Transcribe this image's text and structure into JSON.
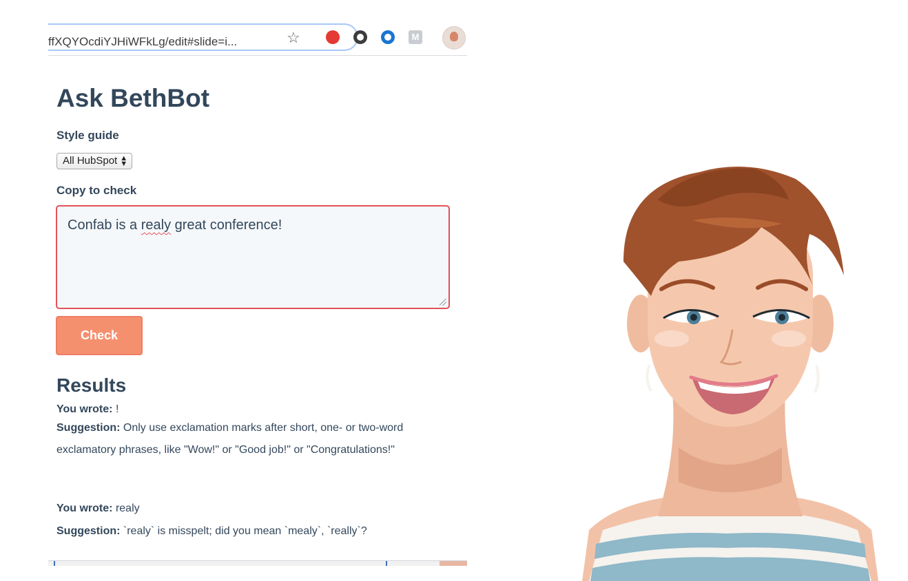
{
  "browser": {
    "url": "ffXQYOcdiYJHiWFkLg/edit#slide=i...",
    "extensions": [
      "adblock-icon",
      "pinterest-icon",
      "circle-icon",
      "m-icon",
      "profile-avatar"
    ],
    "extension_m_label": "M"
  },
  "app": {
    "title": "Ask BethBot",
    "style_guide_label": "Style guide",
    "style_guide_value": "All HubSpot",
    "copy_label": "Copy to check",
    "copy_before": "Confab is a ",
    "copy_misspelled": "realy",
    "copy_after": " great conference!",
    "check_label": "Check",
    "results_title": "Results"
  },
  "results": [
    {
      "wrote_label": "You wrote:",
      "wrote_value": "!",
      "suggestion_label": "Suggestion:",
      "suggestion_text": "Only use exclamation marks after short, one- or two-word exclamatory phrases, like \"Wow!\" or \"Good job!\" or \"Congratulations!\""
    },
    {
      "wrote_label": "You wrote:",
      "wrote_value": "realy",
      "suggestion_label": "Suggestion:",
      "suggestion_text": "`realy` is misspelt; did you mean `mealy`, `really`?"
    }
  ],
  "colors": {
    "heading": "#33475b",
    "error_border": "#e3515a",
    "button": "#f5906f"
  }
}
